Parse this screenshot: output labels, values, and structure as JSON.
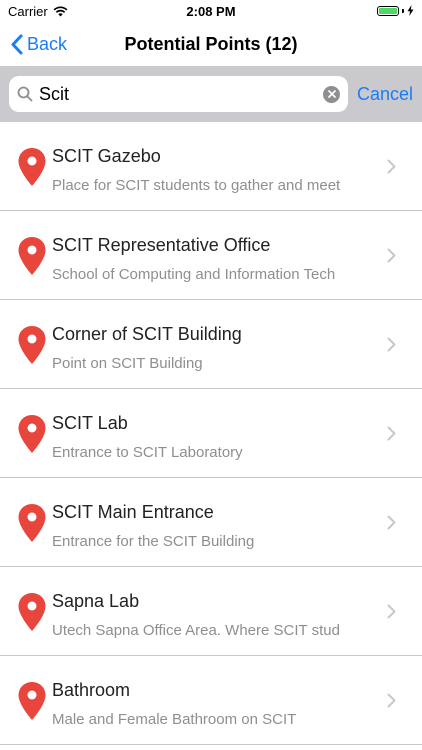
{
  "status_bar": {
    "carrier": "Carrier",
    "time": "2:08 PM",
    "battery_level": 1.0
  },
  "nav": {
    "back_label": "Back",
    "title": "Potential Points (12)"
  },
  "search": {
    "value": "Scit",
    "cancel_label": "Cancel"
  },
  "colors": {
    "accent": "#1a7df5",
    "pin": "#e8453c",
    "search_bar_bg": "#c9c9ce",
    "subtitle": "#8e8e93"
  },
  "list": {
    "items": [
      {
        "title": "SCIT Gazebo",
        "subtitle": "Place for SCIT students to gather and meet"
      },
      {
        "title": "SCIT Representative Office",
        "subtitle": "School of Computing and Information Tech"
      },
      {
        "title": "Corner of SCIT Building",
        "subtitle": "Point on SCIT Building"
      },
      {
        "title": "SCIT Lab",
        "subtitle": "Entrance to SCIT Laboratory"
      },
      {
        "title": "SCIT Main Entrance",
        "subtitle": "Entrance for the SCIT Building"
      },
      {
        "title": "Sapna Lab",
        "subtitle": "Utech Sapna Office Area. Where SCIT stud"
      },
      {
        "title": "Bathroom",
        "subtitle": "Male and Female Bathroom on SCIT"
      }
    ]
  }
}
